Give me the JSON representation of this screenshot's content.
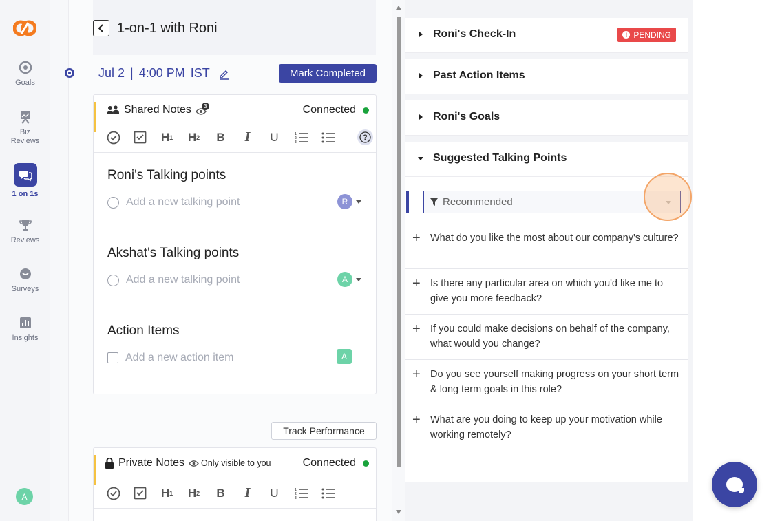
{
  "sidebar": {
    "items": [
      {
        "label": "Goals",
        "icon": "target-icon"
      },
      {
        "label": "Biz\nReviews",
        "label_line1": "Biz",
        "label_line2": "Reviews",
        "icon": "presentation-icon"
      },
      {
        "label": "1 on 1s",
        "icon": "chat-bubbles-icon",
        "active": true
      },
      {
        "label": "Reviews",
        "icon": "trophy-icon"
      },
      {
        "label": "Surveys",
        "icon": "survey-bubble-icon"
      },
      {
        "label": "Insights",
        "icon": "bar-chart-icon"
      }
    ],
    "user_initial": "A"
  },
  "header": {
    "title": "1-on-1 with Roni"
  },
  "meeting": {
    "date": "Jul 2",
    "separator": "|",
    "time": "4:00 PM",
    "timezone": "IST",
    "mark_completed_label": "Mark Completed"
  },
  "shared_notes": {
    "title": "Shared Notes",
    "viewer_count": "3",
    "status": "Connected",
    "sections": [
      {
        "title": "Roni's Talking points",
        "placeholder": "Add a new talking point",
        "avatar": "R",
        "avatar_color": "#8d93d6"
      },
      {
        "title": "Akshat's Talking points",
        "placeholder": "Add a new talking point",
        "avatar": "A",
        "avatar_color": "#6dd3a8"
      },
      {
        "title": "Action Items",
        "placeholder": "Add a new action item",
        "avatar": "A",
        "avatar_color": "#6dd3a8"
      }
    ]
  },
  "toolbar": {
    "h1": "H",
    "h1_sub": "1",
    "h2": "H",
    "h2_sub": "2",
    "bold": "B",
    "italic": "I",
    "underline": "U",
    "help": "?"
  },
  "track_performance_label": "Track Performance",
  "private_notes": {
    "title": "Private Notes",
    "visibility": "Only visible to you",
    "status": "Connected"
  },
  "right_panel": {
    "accordions": [
      {
        "title": "Roni's Check-In",
        "badge": "PENDING",
        "expanded": false
      },
      {
        "title": "Past Action Items",
        "expanded": false
      },
      {
        "title": "Roni's Goals",
        "expanded": false
      },
      {
        "title": "Suggested Talking Points",
        "expanded": true
      }
    ],
    "filter_value": "Recommended",
    "suggestions": [
      "What do you like the most about our company's culture?",
      "Is there any particular area on which you'd like me to give you more feedback?",
      "If you could make decisions on behalf of the company, what would you change?",
      "Do you see yourself making progress on your short term & long term goals in this role?",
      "What are you doing to keep up your motivation while working remotely?"
    ]
  },
  "colors": {
    "accent": "#3b45a3",
    "pending": "#e9494a",
    "connected": "#1aa33c",
    "note_marker": "#f5c242",
    "logo": "#f47b20"
  }
}
